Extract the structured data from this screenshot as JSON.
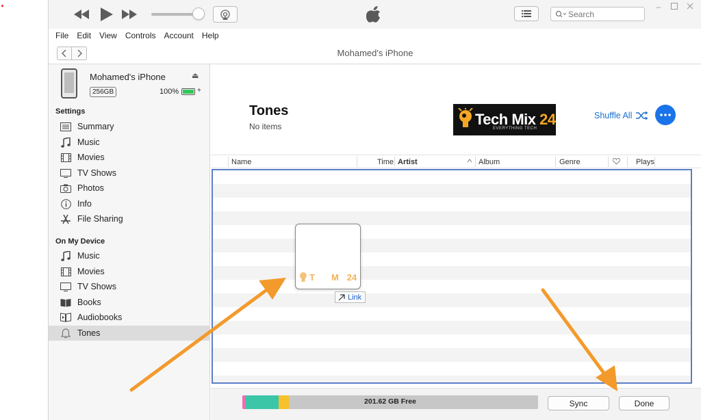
{
  "window": {
    "title": "Mohamed's iPhone"
  },
  "toolbar": {
    "search_placeholder": "Search",
    "icons": [
      "rewind-icon",
      "play-icon",
      "fast-forward-icon",
      "airplay-icon",
      "apple-logo-icon",
      "list-view-icon",
      "search-icon"
    ]
  },
  "menu": {
    "items": [
      "File",
      "Edit",
      "View",
      "Controls",
      "Account",
      "Help"
    ]
  },
  "device": {
    "name": "Mohamed's iPhone",
    "capacity": "256GB",
    "battery": "100%",
    "battery_level": 1.0
  },
  "sidebar": {
    "settings_header": "Settings",
    "settings_items": [
      {
        "label": "Summary",
        "icon": "summary-icon"
      },
      {
        "label": "Music",
        "icon": "music-note-icon"
      },
      {
        "label": "Movies",
        "icon": "film-icon"
      },
      {
        "label": "TV Shows",
        "icon": "tv-icon"
      },
      {
        "label": "Photos",
        "icon": "camera-icon"
      },
      {
        "label": "Info",
        "icon": "info-icon"
      },
      {
        "label": "File Sharing",
        "icon": "app-store-icon"
      }
    ],
    "device_header": "On My Device",
    "device_items": [
      {
        "label": "Music",
        "icon": "music-note-icon"
      },
      {
        "label": "Movies",
        "icon": "film-icon"
      },
      {
        "label": "TV Shows",
        "icon": "tv-icon"
      },
      {
        "label": "Books",
        "icon": "book-icon"
      },
      {
        "label": "Audiobooks",
        "icon": "audiobook-icon"
      },
      {
        "label": "Tones",
        "icon": "bell-icon",
        "selected": true
      }
    ]
  },
  "main": {
    "title": "Tones",
    "subtitle": "No items",
    "logo_text_prefix": "Tech Mix",
    "logo_text_number": "24",
    "logo_tagline": "EVERYTHING TECH",
    "shuffle_label": "Shuffle All",
    "columns": [
      "Name",
      "Time",
      "Artist",
      "Album",
      "Genre",
      "Plays"
    ],
    "sorted_column": "Artist",
    "drag_text_a": "T",
    "drag_text_b": "M",
    "drag_text_c": "24",
    "link_label": "Link"
  },
  "footer": {
    "storage_free": "201.62 GB Free",
    "storage_segments": [
      {
        "color": "#f06ab4",
        "fraction": 0.012
      },
      {
        "color": "#3cc6a8",
        "fraction": 0.11
      },
      {
        "color": "#f6c12a",
        "fraction": 0.035
      },
      {
        "color": "#c7c7c7",
        "fraction": 0.843
      }
    ],
    "sync_label": "Sync",
    "done_label": "Done"
  },
  "colors": {
    "accent": "#1a73e8",
    "arrow": "#f39a2c",
    "drop_border": "#5a7ec8"
  }
}
